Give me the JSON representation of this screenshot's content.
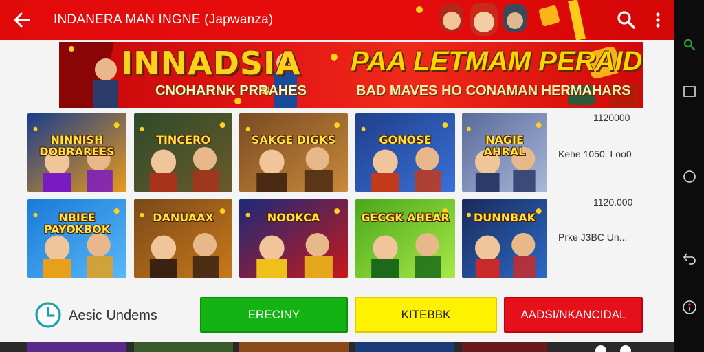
{
  "header": {
    "title": "INDANERA MAN INGNE (Japwanza)"
  },
  "banner": {
    "title_left": "INNADSIA",
    "subtitle_left": "CNOHARNK PRRAHES",
    "headline": "PAA LETMAM PERAIDO!",
    "subline": "BAD MAVES HO CONAMAN HERMAHARS"
  },
  "games": [
    {
      "label": "NINNISH DOBRAREES",
      "colors": [
        "#1a3d8c",
        "#e89a1a",
        "#7a1ac2"
      ]
    },
    {
      "label": "TINCERO",
      "colors": [
        "#2d4a2a",
        "#6a5a2a",
        "#a8321a"
      ]
    },
    {
      "label": "SAKGE DIGKS",
      "colors": [
        "#7a4a22",
        "#c88a3a",
        "#4a2a12"
      ]
    },
    {
      "label": "GONOSE",
      "colors": [
        "#1f3f8a",
        "#3a70d8",
        "#c23a1a"
      ]
    },
    {
      "label": "NAGIE AHRAL",
      "colors": [
        "#5a6a9a",
        "#a8b8d8",
        "#2a3a6a"
      ]
    },
    {
      "label": "NBIEE PAYOKBOK",
      "colors": [
        "#1a7ad8",
        "#58b8f8",
        "#e8a01a"
      ]
    },
    {
      "label": "DANUAAX",
      "colors": [
        "#7a4a1a",
        "#c8781a",
        "#3a2212"
      ]
    },
    {
      "label": "NOOKCA",
      "colors": [
        "#1a2a7a",
        "#c8181a",
        "#f0c01a"
      ]
    },
    {
      "label": "GECGK AHEAR",
      "colors": [
        "#4aa81a",
        "#a8e848",
        "#1a6a1a"
      ]
    },
    {
      "label": "DUNNBAK",
      "colors": [
        "#1a2a5a",
        "#2a6ac8",
        "#c82a2a"
      ]
    }
  ],
  "side_info": {
    "row1_top": "1120000",
    "row1_price": "Kehe 1050. Loo0",
    "row2_top": "1120.000",
    "row2_price": "Prke J3BC Un..."
  },
  "bottom": {
    "status_label": "Aesic Undems",
    "btn_green": "ERECINY",
    "btn_yellow": "KITEBBK",
    "btn_red": "AADSI/NKANCIDAL",
    "colors": {
      "green": "#13b313",
      "yellow": "#fff200",
      "red": "#e5101a"
    }
  },
  "icons": {
    "back": "arrow-left-icon",
    "search": "search-icon",
    "more": "more-vert-icon",
    "clock": "clock-icon",
    "nav_recents": "square-icon",
    "nav_home": "circle-icon",
    "nav_back": "undo-icon"
  }
}
